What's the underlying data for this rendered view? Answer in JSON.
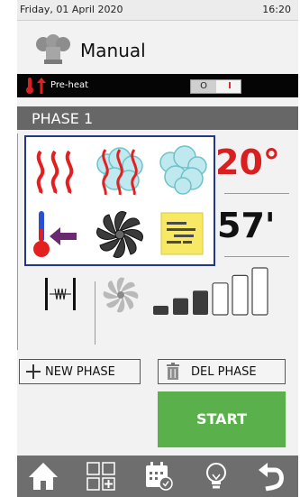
{
  "status": {
    "date": "Friday, 01 April 2020",
    "time": "16:20"
  },
  "mode": {
    "title": "Manual",
    "icon": "chef-hat-icon"
  },
  "preheat": {
    "label": "Pre-heat",
    "toggle_off": "O",
    "toggle_on": "I"
  },
  "phase": {
    "title": "PHASE 1"
  },
  "values": {
    "temperature": "20°",
    "time": "57'"
  },
  "popup": {
    "options": [
      "dry-heat-icon",
      "combi-steam-heat-icon",
      "steam-icon",
      "core-probe-icon",
      "fan-icon",
      "notes-icon"
    ]
  },
  "fan": {
    "speed_level": 3,
    "speed_levels": 6
  },
  "buttons": {
    "new_phase": "NEW PHASE",
    "del_phase": "DEL PHASE",
    "start": "START"
  },
  "nav": [
    "home-icon",
    "add-program-icon",
    "calendar-icon",
    "light-bulb-icon",
    "back-icon"
  ],
  "colors": {
    "accent_green": "#5ab14b",
    "phase_bar": "#676767",
    "popup_border": "#22378a",
    "heat_red": "#d92020"
  }
}
